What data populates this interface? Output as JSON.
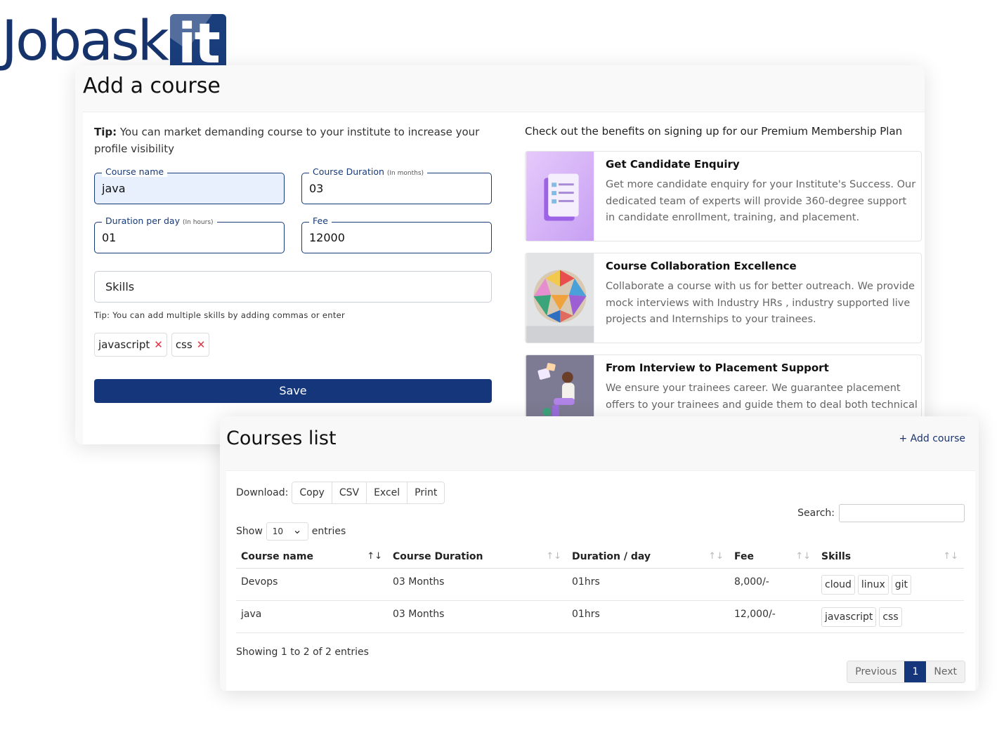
{
  "logo": {
    "text": "Jobask",
    "box_text": "it"
  },
  "add_course": {
    "title": "Add a course",
    "tip_label": "Tip:",
    "tip_text": " You can market demanding course to your institute to increase your profile visibility",
    "fields": {
      "course_name": {
        "label": "Course name",
        "value": "java"
      },
      "course_duration": {
        "label": "Course Duration",
        "hint": "(In months)",
        "value": "03"
      },
      "duration_per_day": {
        "label": "Duration per day",
        "hint": "(In hours)",
        "value": "01"
      },
      "fee": {
        "label": "Fee",
        "value": "12000"
      }
    },
    "skills_placeholder": "Skills",
    "skills_tip": "Tip: You can add multiple skills by adding commas or enter",
    "skills": [
      "javascript",
      "css"
    ],
    "remove_icon": "✕",
    "save_label": "Save"
  },
  "benefits": {
    "title": "Check out the benefits on signing up for our Premium Membership Plan",
    "items": [
      {
        "title": "Get Candidate Enquiry",
        "text": "Get more candidate enquiry for your Institute's Success. Our dedicated team of experts will provide 360-degree support in candidate enrollment, training, and placement.",
        "icon": "checklist-illustration"
      },
      {
        "title": "Course Collaboration Excellence",
        "text": "Collaborate a course with us for better outreach. We provide mock interviews with Industry HRs , industry supported live projects and Internships to your trainees.",
        "icon": "polyhedron-illustration"
      },
      {
        "title": "From Interview to Placement Support",
        "text": "We ensure your trainees career. We guarantee placement offers to your trainees and guide them to deal both technical",
        "icon": "person-illustration"
      }
    ]
  },
  "courses_list": {
    "title": "Courses list",
    "add_course_label": "+ Add course",
    "download_label": "Download:",
    "download_buttons": [
      "Copy",
      "CSV",
      "Excel",
      "Print"
    ],
    "search_label": "Search:",
    "show_label": "Show",
    "entries_value": "10",
    "entries_label": "entries",
    "columns": [
      "Course name",
      "Course Duration",
      "Duration / day",
      "Fee",
      "Skills"
    ],
    "rows": [
      {
        "course_name": "Devops",
        "duration": "03 Months",
        "per_day": "01hrs",
        "fee": "8,000/-",
        "skills": [
          "cloud",
          "linux",
          "git"
        ]
      },
      {
        "course_name": "java",
        "duration": "03 Months",
        "per_day": "01hrs",
        "fee": "12,000/-",
        "skills": [
          "javascript",
          "css"
        ]
      }
    ],
    "showing": "Showing 1 to 2 of 2 entries",
    "pager": {
      "prev": "Previous",
      "page": "1",
      "next": "Next"
    }
  },
  "colors": {
    "brand": "#15367a",
    "field_border": "#173a78",
    "remove": "#dc3545"
  }
}
